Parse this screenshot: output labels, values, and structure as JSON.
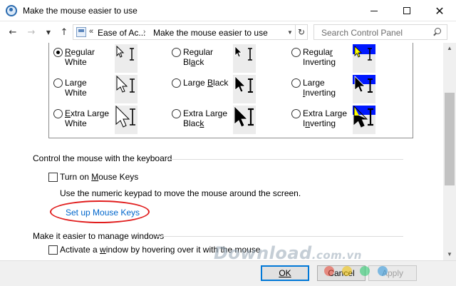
{
  "window": {
    "title": "Make the mouse easier to use",
    "controls": {
      "minimize": "minimize",
      "maximize": "maximize",
      "close": "✕"
    }
  },
  "address_bar": {
    "overflow": "«",
    "crumb1": "Ease of Ac...",
    "separator": "›",
    "crumb2": "Make the mouse easier to use",
    "search_placeholder": "Search Control Panel"
  },
  "cursor_schemes": [
    {
      "label": "Regular White",
      "checked": true
    },
    {
      "label": "Regular Black",
      "checked": false
    },
    {
      "label": "Regular Inverting",
      "checked": false
    },
    {
      "label": "Large White",
      "checked": false
    },
    {
      "label": "Large Black",
      "checked": false
    },
    {
      "label": "Large Inverting",
      "checked": false
    },
    {
      "label": "Extra Large White",
      "checked": false
    },
    {
      "label": "Extra Large Black",
      "checked": false
    },
    {
      "label": "Extra Large Inverting",
      "checked": false
    }
  ],
  "mouse_keys": {
    "section_title": "Control the mouse with the keyboard",
    "checkbox_label": "Turn on Mouse Keys",
    "description": "Use the numeric keypad to move the mouse around the screen.",
    "setup_link": "Set up Mouse Keys"
  },
  "windows_mgmt": {
    "section_title": "Make it easier to manage windows",
    "checkbox_label": "Activate a window by hovering over it with the mouse"
  },
  "buttons": {
    "ok": "OK",
    "cancel": "Cancel",
    "apply": "Apply"
  },
  "watermark": {
    "main": "Download",
    "suffix": ".com.vn"
  },
  "colors": {
    "link": "#0066cc",
    "annotation": "#e11d1d",
    "inverting_blue": "#0018ff"
  }
}
